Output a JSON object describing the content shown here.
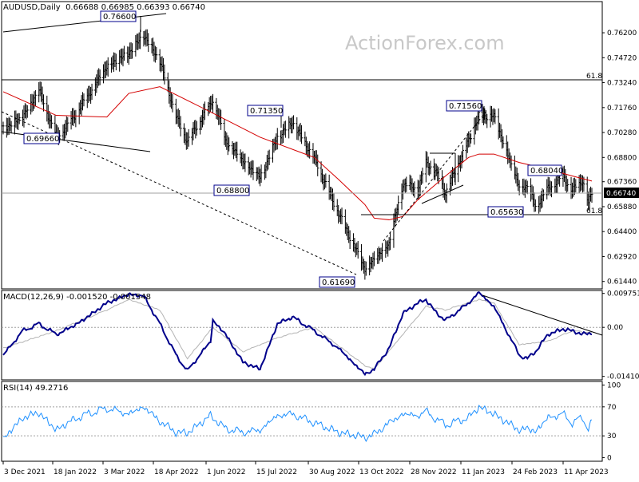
{
  "header": {
    "main": "AUDUSD,Daily  0.66688 0.66985 0.66393 0.66740",
    "macd": "MACD(12,26,9) -0.001520 -0.001548",
    "rsi": "RSI(14) 49.2716"
  },
  "watermark": "ActionForex.com",
  "colors": {
    "price": "#000000",
    "sma": "#d40000",
    "macd_line": "#00008b",
    "macd_signal": "#b4b4b4",
    "rsi": "#1e90ff",
    "annot_bg": "#ffffff",
    "annot_border": "#00008b",
    "current_bg": "#000000",
    "current_fg": "#ffffff"
  },
  "chart_data": [
    {
      "type": "line",
      "panel": "price",
      "title": "AUDUSD,Daily",
      "ohlc": {
        "open": 0.66688,
        "high": 0.66985,
        "low": 0.66393,
        "close": 0.6674
      },
      "ylim": [
        0.61,
        0.7805
      ],
      "y_ticks": [
        "0.76200",
        "0.74720",
        "0.73240",
        "0.71760",
        "0.70280",
        "0.68800",
        "0.67360",
        "0.65880",
        "0.64400",
        "0.62920",
        "0.61440"
      ],
      "current_price_label": "0.66740",
      "x_ticks": [
        "3 Dec 2021",
        "18 Jan 2022",
        "3 Mar 2022",
        "18 Apr 2022",
        "1 Jun 2022",
        "15 Jul 2022",
        "30 Aug 2022",
        "13 Oct 2022",
        "28 Nov 2022",
        "11 Jan 2023",
        "24 Feb 2023",
        "11 Apr 2023"
      ],
      "series": [
        {
          "x": [
            "2021-12-03",
            "2021-12-20",
            "2022-01-03",
            "2022-01-18",
            "2022-01-28",
            "2022-02-10",
            "2022-03-03",
            "2022-03-22",
            "2022-04-04",
            "2022-04-18",
            "2022-05-02",
            "2022-05-12",
            "2022-06-01",
            "2022-06-03",
            "2022-06-14",
            "2022-06-29",
            "2022-07-14",
            "2022-07-29",
            "2022-08-11",
            "2022-08-30",
            "2022-09-20",
            "2022-10-13",
            "2022-10-21",
            "2022-11-03",
            "2022-11-15",
            "2022-11-28",
            "2022-12-05",
            "2022-12-13",
            "2022-12-22",
            "2023-01-11",
            "2023-01-20",
            "2023-02-02",
            "2023-02-24",
            "2023-03-03",
            "2023-03-10",
            "2023-03-21",
            "2023-04-03",
            "2023-04-11",
            "2023-04-20",
            "2023-04-25",
            "2023-04-28"
          ],
          "values": [
            0.705,
            0.712,
            0.728,
            0.7,
            0.707,
            0.72,
            0.742,
            0.75,
            0.7605,
            0.745,
            0.712,
            0.6975,
            0.72,
            0.7225,
            0.698,
            0.686,
            0.676,
            0.6998,
            0.709,
            0.6875,
            0.655,
            0.622,
            0.6275,
            0.637,
            0.6725,
            0.669,
            0.685,
            0.68,
            0.667,
            0.6982,
            0.7125,
            0.7125,
            0.6705,
            0.671,
            0.659,
            0.6695,
            0.6765,
            0.6682,
            0.6745,
            0.6605,
            0.6674
          ]
        },
        {
          "name": "",
          "x": [
            "2021-12-03",
            "2022-01-18",
            "2022-03-03",
            "2022-03-22",
            "2022-04-18",
            "2022-06-01",
            "2022-07-14",
            "2022-08-30",
            "2022-09-20",
            "2022-10-13",
            "2022-10-21",
            "2022-11-03",
            "2022-11-15",
            "2022-11-28",
            "2022-12-22",
            "2023-01-11",
            "2023-01-20",
            "2023-02-02",
            "2023-02-24",
            "2023-03-21",
            "2023-04-11",
            "2023-04-28"
          ],
          "values": [
            0.727,
            0.713,
            0.712,
            0.726,
            0.73,
            0.715,
            0.7,
            0.688,
            0.675,
            0.66,
            0.652,
            0.651,
            0.653,
            0.663,
            0.677,
            0.688,
            0.69,
            0.69,
            0.685,
            0.681,
            0.677,
            0.674
          ]
        }
      ],
      "annotations": [
        "0.76600",
        "0.71350",
        "0.68800",
        "0.69660",
        "0.61690",
        "0.71560",
        "0.68040",
        "0.65630"
      ],
      "fib_labels": [
        "61.8",
        "61.8"
      ]
    },
    {
      "type": "line",
      "panel": "macd",
      "title": "MACD(12,26,9)",
      "values_shown": {
        "macd": -0.00152,
        "signal": -0.001548
      },
      "ylim": [
        -0.0151,
        0.0106
      ],
      "y_ticks": [
        "0.009751",
        "0.00",
        "-0.014107"
      ],
      "current_label": "0.00",
      "series": [
        {
          "x": [
            "2021-12-03",
            "2021-12-20",
            "2022-01-03",
            "2022-01-18",
            "2022-01-28",
            "2022-02-10",
            "2022-03-03",
            "2022-03-22",
            "2022-04-04",
            "2022-04-18",
            "2022-05-02",
            "2022-05-12",
            "2022-06-01",
            "2022-06-03",
            "2022-06-14",
            "2022-06-29",
            "2022-07-14",
            "2022-07-29",
            "2022-08-11",
            "2022-08-30",
            "2022-09-20",
            "2022-10-13",
            "2022-10-21",
            "2022-11-03",
            "2022-11-15",
            "2022-11-28",
            "2022-12-05",
            "2022-12-13",
            "2022-12-22",
            "2023-01-11",
            "2023-01-20",
            "2023-02-02",
            "2023-02-24",
            "2023-03-03",
            "2023-03-10",
            "2023-03-21",
            "2023-04-03",
            "2023-04-11",
            "2023-04-20",
            "2023-04-25",
            "2023-04-28"
          ],
          "values": [
            -0.008,
            -0.001,
            0.001,
            -0.002,
            -0.0005,
            0.002,
            0.007,
            0.0095,
            0.009,
            0.001,
            -0.008,
            -0.0125,
            -0.004,
            0.002,
            -0.002,
            -0.01,
            -0.012,
            0.001,
            0.003,
            -0.001,
            -0.006,
            -0.0135,
            -0.012,
            -0.006,
            0.004,
            0.007,
            0.008,
            0.0045,
            0.002,
            0.007,
            0.01,
            0.006,
            -0.008,
            -0.009,
            -0.007,
            -0.002,
            -0.0005,
            -0.001,
            -0.002,
            -0.0018,
            -0.0015
          ]
        },
        {
          "x": [
            "2021-12-03",
            "2022-01-18",
            "2022-03-03",
            "2022-03-22",
            "2022-04-18",
            "2022-05-12",
            "2022-06-03",
            "2022-06-29",
            "2022-07-29",
            "2022-08-30",
            "2022-10-13",
            "2022-10-21",
            "2022-11-15",
            "2022-12-05",
            "2022-12-22",
            "2023-01-20",
            "2023-02-02",
            "2023-02-24",
            "2023-03-21",
            "2023-04-11",
            "2023-04-28"
          ],
          "values": [
            -0.006,
            -0.001,
            0.005,
            0.008,
            0.005,
            -0.009,
            0.0,
            -0.007,
            -0.003,
            0.0,
            -0.011,
            -0.012,
            -0.002,
            0.006,
            0.005,
            0.008,
            0.007,
            -0.005,
            -0.004,
            -0.001,
            -0.0015
          ]
        }
      ]
    },
    {
      "type": "line",
      "panel": "rsi",
      "title": "RSI(14)",
      "value_shown": 49.2716,
      "ylim": [
        0,
        100
      ],
      "y_ticks": [
        "100",
        "70",
        "30",
        "0"
      ],
      "levels": [
        70,
        30
      ],
      "series": [
        {
          "x": [
            "2021-12-03",
            "2021-12-20",
            "2022-01-03",
            "2022-01-18",
            "2022-01-28",
            "2022-02-10",
            "2022-03-03",
            "2022-03-22",
            "2022-04-04",
            "2022-04-18",
            "2022-05-02",
            "2022-05-12",
            "2022-06-01",
            "2022-06-03",
            "2022-06-14",
            "2022-06-29",
            "2022-07-14",
            "2022-07-29",
            "2022-08-11",
            "2022-08-30",
            "2022-09-20",
            "2022-10-13",
            "2022-10-21",
            "2022-11-03",
            "2022-11-15",
            "2022-11-28",
            "2022-12-05",
            "2022-12-13",
            "2022-12-22",
            "2023-01-11",
            "2023-01-20",
            "2023-02-02",
            "2023-02-24",
            "2023-03-03",
            "2023-03-10",
            "2023-03-21",
            "2023-04-03",
            "2023-04-11",
            "2023-04-20",
            "2023-04-25",
            "2023-04-28"
          ],
          "values": [
            26,
            55,
            62,
            38,
            48,
            58,
            68,
            60,
            70,
            50,
            35,
            34,
            58,
            55,
            40,
            35,
            38,
            58,
            60,
            48,
            35,
            28,
            32,
            48,
            60,
            58,
            64,
            54,
            45,
            55,
            70,
            60,
            38,
            40,
            36,
            55,
            60,
            48,
            55,
            40,
            49.27
          ]
        }
      ]
    }
  ]
}
